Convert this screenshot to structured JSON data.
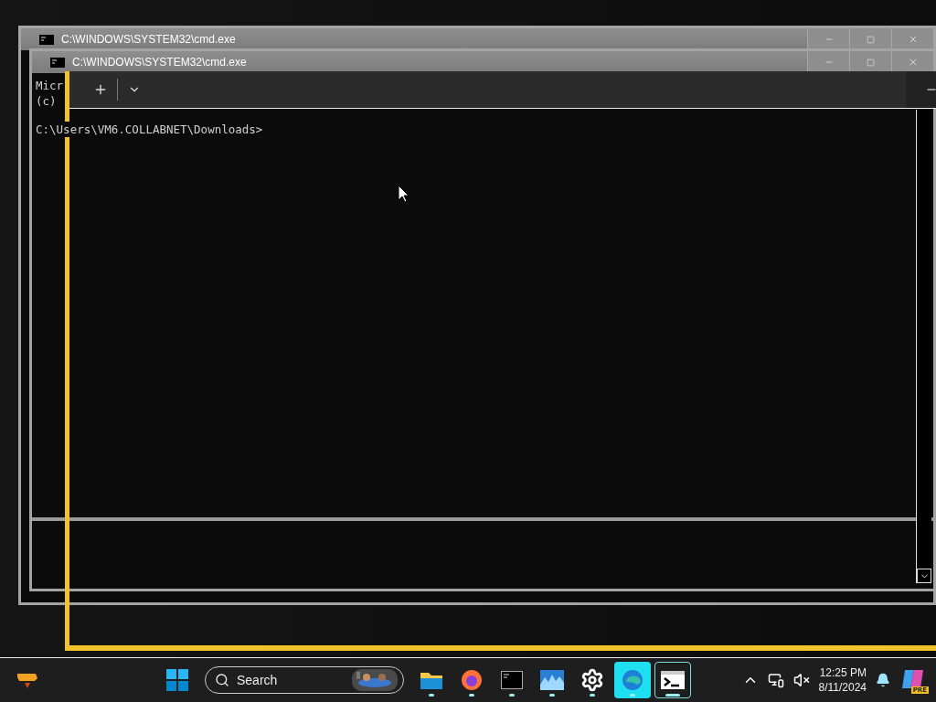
{
  "back_windows": [
    {
      "title": "C:\\WINDOWS\\SYSTEM32\\cmd.exe"
    },
    {
      "title": "C:\\WINDOWS\\SYSTEM32\\cmd.exe"
    }
  ],
  "console": {
    "lines": [
      "Micr",
      "(c)"
    ],
    "prompt": "C:\\Users\\VM6.COLLABNET\\Downloads>"
  },
  "terminal": {
    "tab_buttons": [
      {
        "kind": "new-tab"
      },
      {
        "kind": "dropdown"
      }
    ]
  },
  "taskbar": {
    "search": {
      "placeholder": "Search"
    },
    "apps": [
      {
        "kind": "explorer",
        "running": true,
        "selected": false,
        "highlighted": false
      },
      {
        "kind": "browser",
        "running": true,
        "selected": false,
        "highlighted": false
      },
      {
        "kind": "cmd",
        "running": true,
        "selected": false,
        "highlighted": false
      },
      {
        "kind": "monitor",
        "running": true,
        "selected": false,
        "highlighted": false
      },
      {
        "kind": "settings",
        "running": true,
        "selected": false,
        "highlighted": false
      },
      {
        "kind": "edge",
        "running": true,
        "selected": false,
        "highlighted": true
      },
      {
        "kind": "terminal",
        "running": true,
        "selected": true,
        "highlighted": false
      }
    ],
    "time": "12:25 PM",
    "date": "8/11/2024",
    "badge": "PRE"
  }
}
